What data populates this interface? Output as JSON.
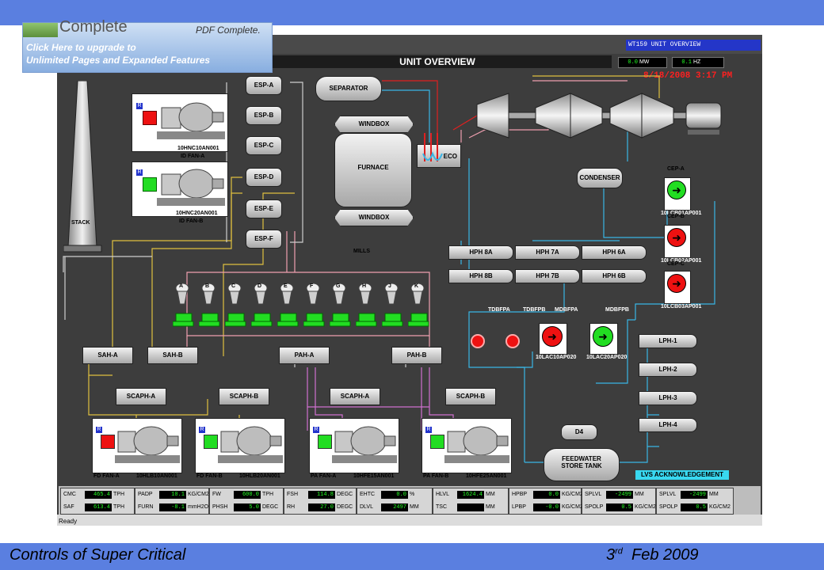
{
  "promo": {
    "title": "Complete",
    "pdf_label": "PDF Complete.",
    "line1": "Click Here to upgrade to",
    "line2": "Unlimited Pages and Expanded Features"
  },
  "window": {
    "tag": "WT159 UNIT OVERVIEW",
    "heading": "UNIT OVERVIEW",
    "mw_value": "0.0",
    "mw_unit": "MW",
    "hz_value": "0.1",
    "hz_unit": "HZ",
    "datetime": "8/18/2008 3:17 PM",
    "status": "Ready"
  },
  "equipment": {
    "separator": "SEPARATOR",
    "windbox_top": "WINDBOX",
    "furnace": "FURNACE",
    "windbox_bottom": "WINDBOX",
    "eco": "ECO",
    "condenser": "CONDENSER",
    "stack": "STACK",
    "mills_label": "MILLS",
    "esp": [
      "ESP-A",
      "ESP-B",
      "ESP-C",
      "ESP-D",
      "ESP-E",
      "ESP-F"
    ],
    "id_fan_a_tag": "10HNC10AN001",
    "id_fan_a_name": "ID FAN-A",
    "id_fan_b_tag": "10HNC20AN001",
    "id_fan_b_name": "ID FAN-B",
    "hph": [
      "HPH 8A",
      "HPH 7A",
      "HPH 6A",
      "HPH 8B",
      "HPH 7B",
      "HPH 6B"
    ],
    "cep": [
      {
        "name": "CEP-A",
        "tag": "10LCB01AP001",
        "color": "#22dd22"
      },
      {
        "name": "CEP-B",
        "tag": "10LCB02AP001",
        "color": "#ee1111"
      },
      {
        "name": "CEP-C",
        "tag": "10LCB03AP001",
        "color": "#ee1111"
      }
    ],
    "mills": [
      "A",
      "B",
      "C",
      "D",
      "E",
      "F",
      "G",
      "H",
      "J",
      "K"
    ],
    "tdbfpa": "TDBFPA",
    "tdbfpb": "TDBFPB",
    "mdbfpa": "MDBFPA",
    "mdbfpb": "MDBFPB",
    "mdbfpa_tag": "10LAC10AP020",
    "mdbfpb_tag": "10LAC20AP020",
    "lph": [
      "LPH-1",
      "LPH-2",
      "LPH-3",
      "LPH-4"
    ],
    "sah": [
      "SAH-A",
      "SAH-B"
    ],
    "pah": [
      "PAH-A",
      "PAH-B"
    ],
    "scaph": [
      "SCAPH-A",
      "SCAPH-B",
      "SCAPH-A",
      "SCAPH-B"
    ],
    "d4": "D4",
    "feedwater": "FEEDWATER",
    "store_tank": "STORE TANK",
    "ack": "LVS ACKNOWLEDGEMENT",
    "fans": [
      {
        "name": "FD FAN-A",
        "tag": "10HLB10AN001",
        "color": "#ee1111"
      },
      {
        "name": "FD FAN-B",
        "tag": "10HLB20AN001",
        "color": "#22dd22"
      },
      {
        "name": "PA FAN-A",
        "tag": "10HFE15AN001",
        "color": "#22dd22"
      },
      {
        "name": "PA FAN-B",
        "tag": "10HFE25AN001",
        "color": "#22dd22"
      }
    ]
  },
  "readouts": [
    [
      {
        "n": "CMC",
        "v": "465.4",
        "u": "TPH"
      },
      {
        "n": "SAF",
        "v": "613.4",
        "u": "TPH"
      }
    ],
    [
      {
        "n": "PADP",
        "v": "10.1",
        "u": "KG/CM2"
      },
      {
        "n": "FURN",
        "v": "-8.1",
        "u": "mmH2O"
      }
    ],
    [
      {
        "n": "FW",
        "v": "600.0",
        "u": "TPH"
      },
      {
        "n": "PHSH",
        "v": "5.0",
        "u": "DEGC"
      }
    ],
    [
      {
        "n": "FSH",
        "v": "114.8",
        "u": "DEGC"
      },
      {
        "n": "RH",
        "v": "27.0",
        "u": "DEGC"
      }
    ],
    [
      {
        "n": "EHTC",
        "v": "0.0",
        "u": "%"
      },
      {
        "n": "DLVL",
        "v": "2497",
        "u": "MM"
      }
    ],
    [
      {
        "n": "HLVL",
        "v": "1624.4",
        "u": "MM"
      },
      {
        "n": "TSC",
        "v": "",
        "u": "MM"
      }
    ],
    [
      {
        "n": "HPBP",
        "v": "0.0",
        "u": "KG/CM2"
      },
      {
        "n": "LPBP",
        "v": "-0.0",
        "u": "KG/CM2"
      }
    ],
    [
      {
        "n": "SPLVL",
        "v": "-2499",
        "u": "MM"
      },
      {
        "n": "SPOLP",
        "v": "0.5",
        "u": "KG/CM2"
      }
    ],
    [
      {
        "n": "SPLVL",
        "v": "-2499",
        "u": "MM"
      },
      {
        "n": "SPOLP",
        "v": "0.5",
        "u": "KG/CM2"
      }
    ]
  ],
  "footer": {
    "left": "Controls of  Super Critical",
    "date_num": "3",
    "date_sup": "rd",
    "date_rest": "Feb 2009"
  },
  "colors": {
    "canvas": "#3d3d3d",
    "water_line": "#38b6e6",
    "steam_line": "#e02020",
    "air_line": "#e0c040",
    "coal_line": "#f0a0b0",
    "pa_line": "#d070d0"
  }
}
